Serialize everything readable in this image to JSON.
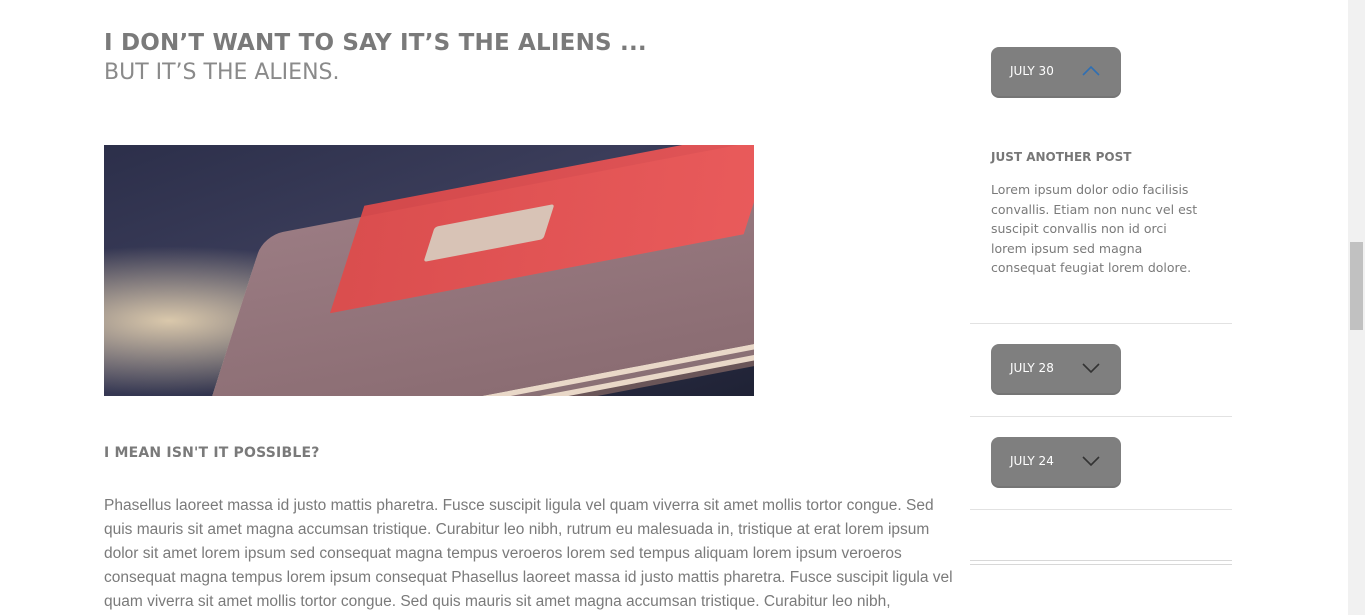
{
  "post": {
    "title": "I DON’T WANT TO SAY IT’S THE ALIENS ...",
    "subtitle": "BUT IT’S THE ALIENS.",
    "section_heading": "I MEAN ISN'T IT POSSIBLE?",
    "body": "Phasellus laoreet massa id justo mattis pharetra. Fusce suscipit ligula vel quam viverra sit amet mollis tortor congue. Sed quis mauris sit amet magna accumsan tristique. Curabitur leo nibh, rutrum eu malesuada in, tristique at erat lorem ipsum dolor sit amet lorem ipsum sed consequat magna tempus veroeros lorem sed tempus aliquam lorem ipsum veroeros consequat magna tempus lorem ipsum consequat Phasellus laoreet massa id justo mattis pharetra. Fusce suscipit ligula vel quam viverra sit amet mollis tortor congue. Sed quis mauris sit amet magna accumsan tristique. Curabitur leo nibh,"
  },
  "sidebar": {
    "archive": [
      {
        "date": "JULY 30",
        "expanded": true,
        "icon": "chevron-up-icon"
      },
      {
        "date": "JULY 28",
        "expanded": false,
        "icon": "chevron-down-icon"
      },
      {
        "date": "JULY 24",
        "expanded": false,
        "icon": "chevron-down-icon"
      }
    ],
    "expanded_post": {
      "title": "JUST ANOTHER POST",
      "text": "Lorem ipsum dolor odio facilisis convallis. Etiam non nunc vel est suscipit convallis non id orci lorem ipsum sed magna consequat feugiat lorem dolore."
    }
  },
  "colors": {
    "button_bg": "#7f7f7f",
    "chevron_up": "#2f6fb3",
    "chevron_down": "#333333",
    "text": "#7a7a7a"
  }
}
